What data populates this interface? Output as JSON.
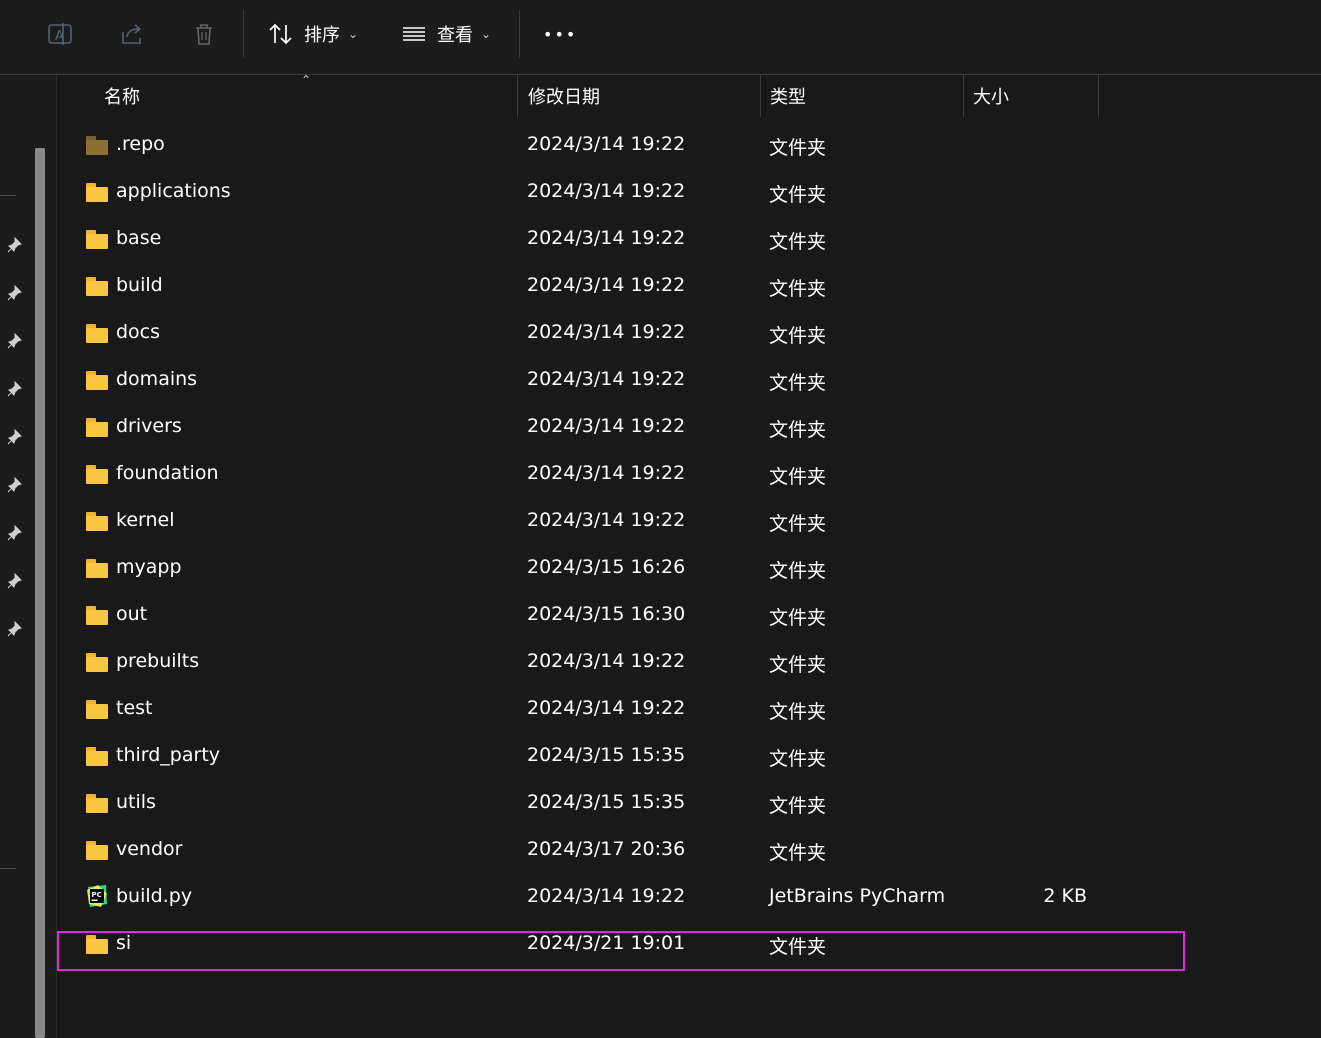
{
  "toolbar": {
    "sort_label": "排序",
    "view_label": "查看",
    "more_label": "•••",
    "icons": [
      "rename-icon",
      "share-icon",
      "delete-icon",
      "sort-icon",
      "view-icon",
      "more-icon"
    ]
  },
  "columns": {
    "name": "名称",
    "modified": "修改日期",
    "type": "类型",
    "size": "大小"
  },
  "files": [
    {
      "name": ".repo",
      "modified": "2024/3/14 19:22",
      "type": "文件夹",
      "size": "",
      "icon": "folder-icon"
    },
    {
      "name": "applications",
      "modified": "2024/3/14 19:22",
      "type": "文件夹",
      "size": "",
      "icon": "folder-icon"
    },
    {
      "name": "base",
      "modified": "2024/3/14 19:22",
      "type": "文件夹",
      "size": "",
      "icon": "folder-icon"
    },
    {
      "name": "build",
      "modified": "2024/3/14 19:22",
      "type": "文件夹",
      "size": "",
      "icon": "folder-icon"
    },
    {
      "name": "docs",
      "modified": "2024/3/14 19:22",
      "type": "文件夹",
      "size": "",
      "icon": "folder-icon"
    },
    {
      "name": "domains",
      "modified": "2024/3/14 19:22",
      "type": "文件夹",
      "size": "",
      "icon": "folder-icon"
    },
    {
      "name": "drivers",
      "modified": "2024/3/14 19:22",
      "type": "文件夹",
      "size": "",
      "icon": "folder-icon"
    },
    {
      "name": "foundation",
      "modified": "2024/3/14 19:22",
      "type": "文件夹",
      "size": "",
      "icon": "folder-icon"
    },
    {
      "name": "kernel",
      "modified": "2024/3/14 19:22",
      "type": "文件夹",
      "size": "",
      "icon": "folder-icon"
    },
    {
      "name": "myapp",
      "modified": "2024/3/15 16:26",
      "type": "文件夹",
      "size": "",
      "icon": "folder-icon"
    },
    {
      "name": "out",
      "modified": "2024/3/15 16:30",
      "type": "文件夹",
      "size": "",
      "icon": "folder-icon"
    },
    {
      "name": "prebuilts",
      "modified": "2024/3/14 19:22",
      "type": "文件夹",
      "size": "",
      "icon": "folder-icon"
    },
    {
      "name": "test",
      "modified": "2024/3/14 19:22",
      "type": "文件夹",
      "size": "",
      "icon": "folder-icon"
    },
    {
      "name": "third_party",
      "modified": "2024/3/15 15:35",
      "type": "文件夹",
      "size": "",
      "icon": "folder-icon"
    },
    {
      "name": "utils",
      "modified": "2024/3/15 15:35",
      "type": "文件夹",
      "size": "",
      "icon": "folder-icon"
    },
    {
      "name": "vendor",
      "modified": "2024/3/17 20:36",
      "type": "文件夹",
      "size": "",
      "icon": "folder-icon"
    },
    {
      "name": "build.py",
      "modified": "2024/3/14 19:22",
      "type": "JetBrains PyCharm",
      "size": "2 KB",
      "icon": "pycharm-file-icon"
    },
    {
      "name": "si",
      "modified": "2024/3/21 19:01",
      "type": "文件夹",
      "size": "",
      "icon": "folder-icon"
    }
  ],
  "colors": {
    "background": "#191919",
    "folder": "#f8c640",
    "highlight": "#e026e0"
  }
}
